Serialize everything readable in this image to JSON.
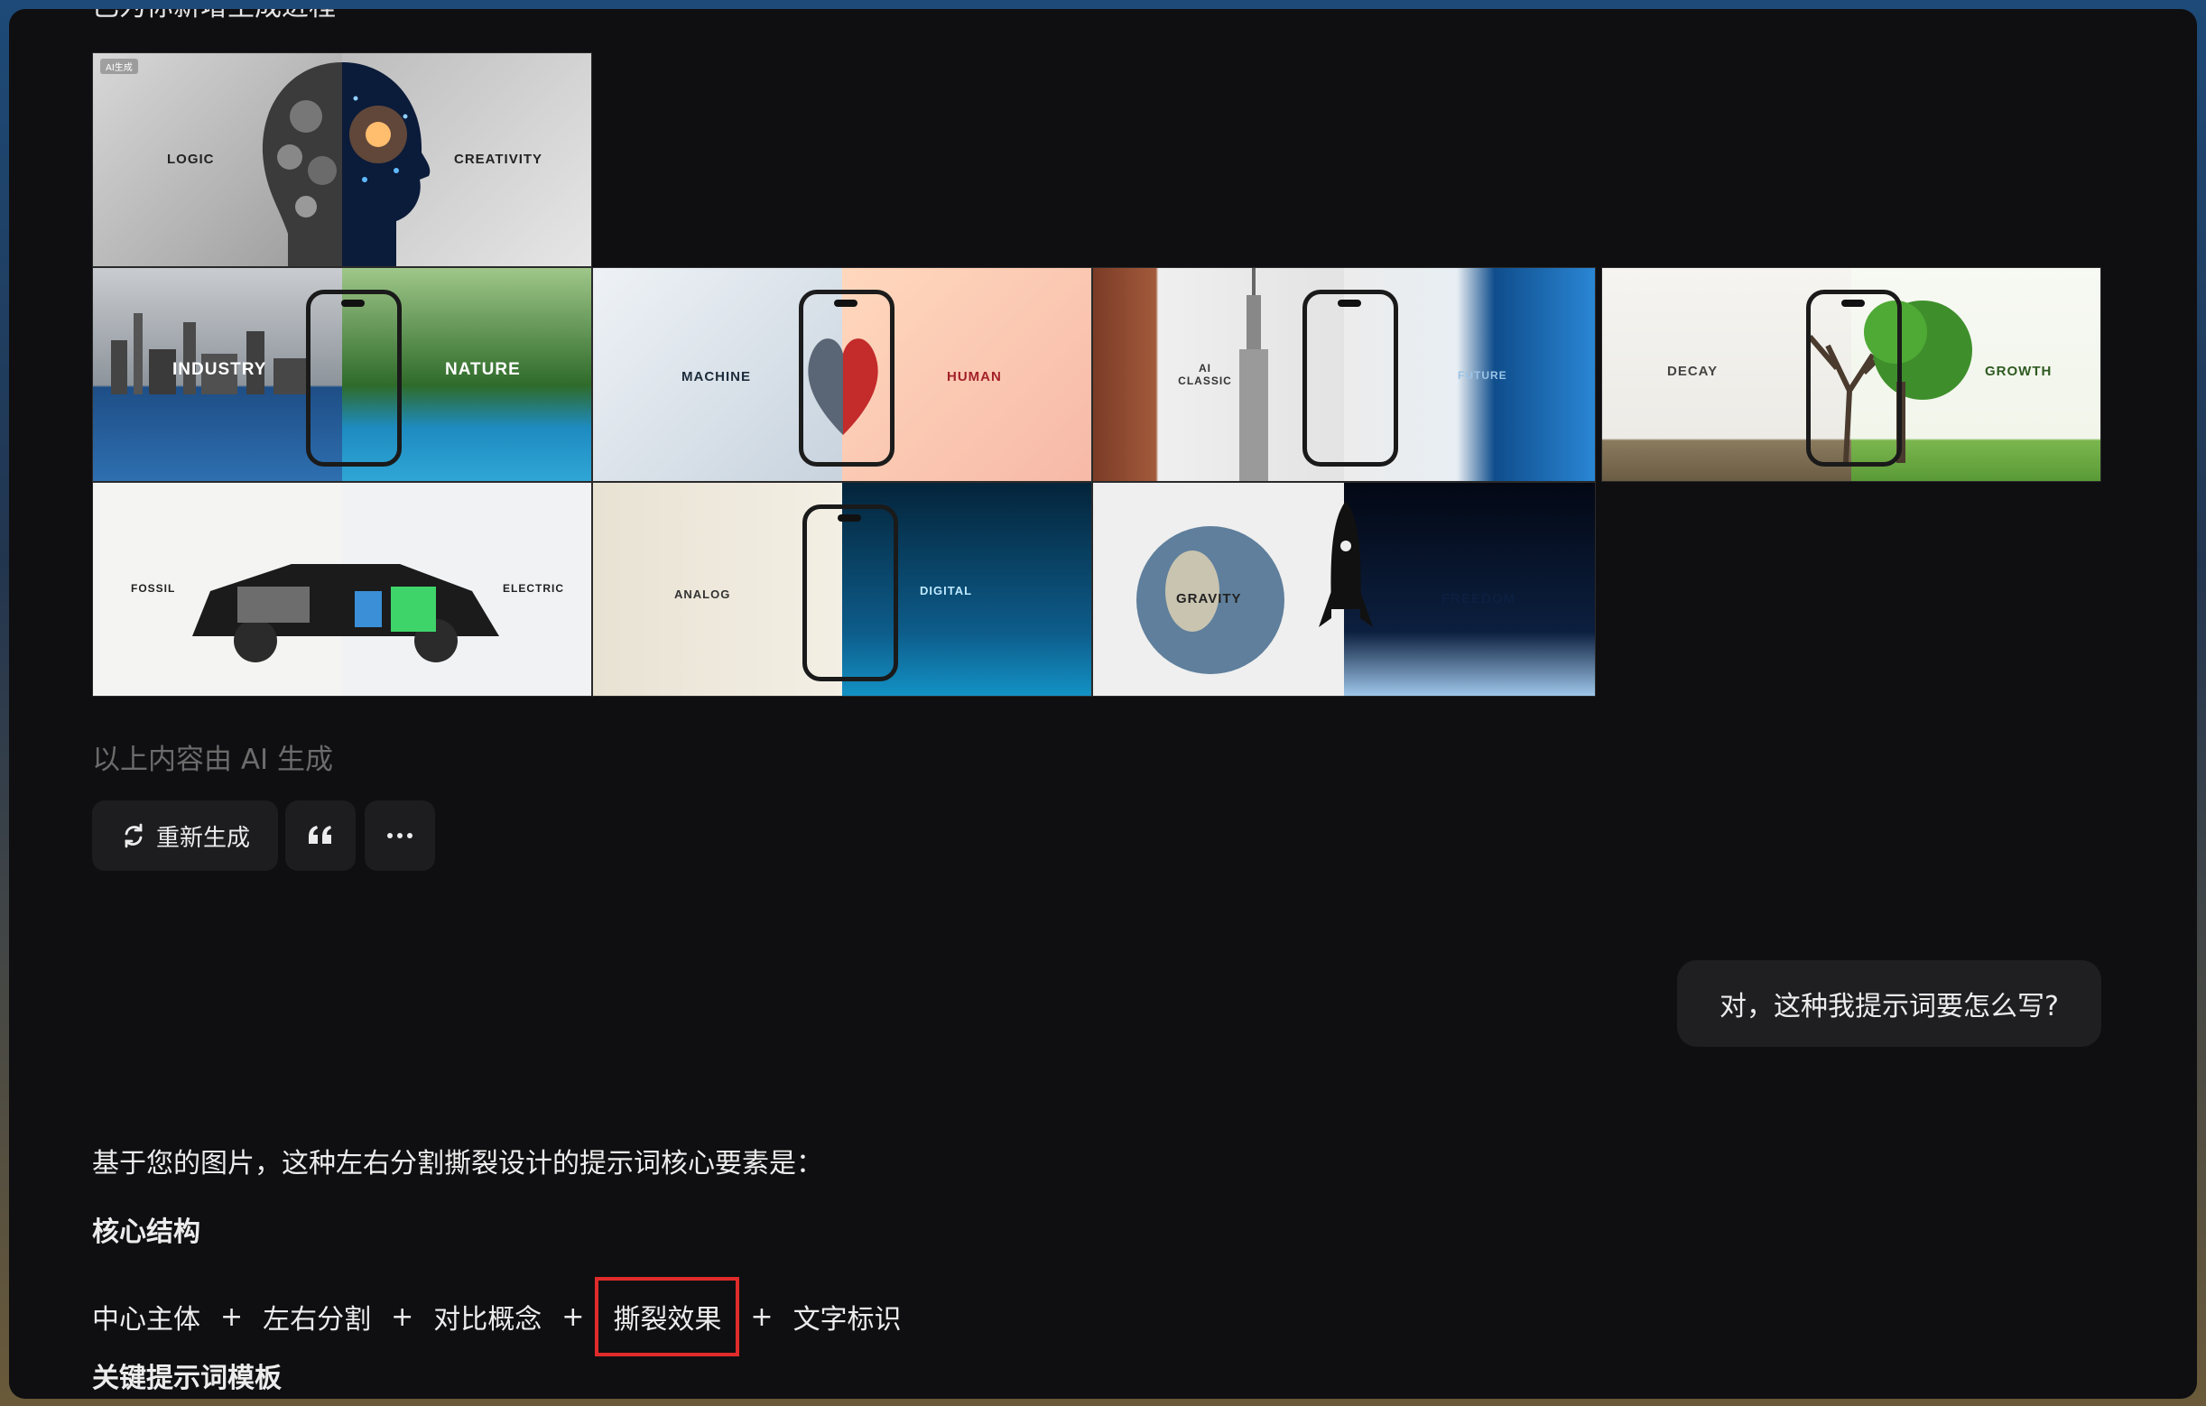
{
  "heading_partial": "已为你新增生成进程",
  "images": [
    {
      "left": "LOGIC",
      "right": "CREATIVITY",
      "badge": "AI生成"
    },
    {
      "left": "INDUSTRY",
      "right": "NATURE"
    },
    {
      "left": "MACHINE",
      "right": "HUMAN"
    },
    {
      "left": "AI CLASSIC",
      "right": "FUTURE"
    },
    {
      "left": "DECAY",
      "right": "GROWTH"
    },
    {
      "left": "FOSSIL",
      "right": "ELECTRIC"
    },
    {
      "left": "ANALOG",
      "right": "DIGITAL"
    },
    {
      "left": "GRAVITY",
      "right": "FREEDOM"
    }
  ],
  "ai_notice": "以上内容由 AI 生成",
  "actions": {
    "regenerate": "重新生成",
    "quote_icon": "quote-icon",
    "more_icon": "more-icon"
  },
  "user_message": "对，这种我提示词要怎么写?",
  "answer": {
    "intro": "基于您的图片，这种左右分割撕裂设计的提示词核心要素是：",
    "section1": "核心结构",
    "formula": [
      "中心主体",
      "左右分割",
      "对比概念",
      "撕裂效果",
      "文字标识"
    ],
    "plus": "+",
    "section2": "关键提示词模板"
  },
  "colors": {
    "background": "#0f0f11",
    "highlight_box": "#e02b2b",
    "muted_text": "#6b6b6b"
  }
}
